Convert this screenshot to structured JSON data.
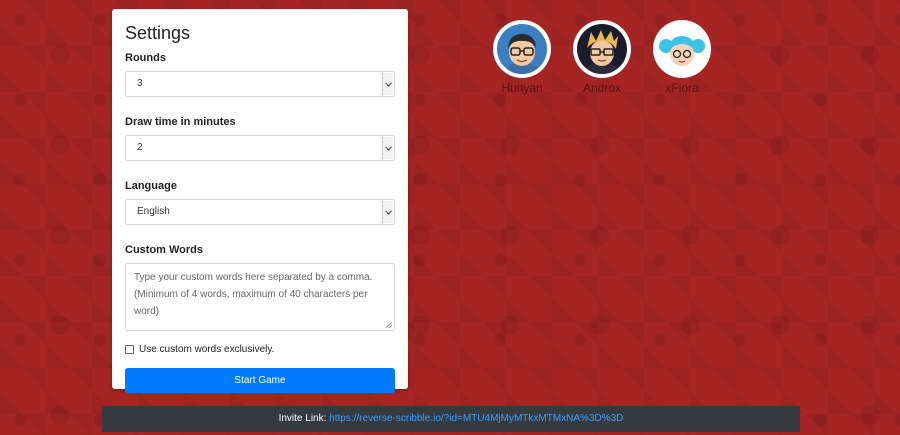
{
  "settings": {
    "title": "Settings",
    "rounds": {
      "label": "Rounds",
      "value": "3"
    },
    "draw_time": {
      "label": "Draw time in minutes",
      "value": "2"
    },
    "language": {
      "label": "Language",
      "value": "English"
    },
    "custom_words": {
      "label": "Custom Words",
      "placeholder": "Type your custom words here separated by a comma. (Minimum of 4 words, maximum of 40 characters per word)"
    },
    "exclusive_checkbox": {
      "label": "Use custom words exclusively.",
      "checked": false
    },
    "start_button": "Start Game"
  },
  "players": [
    {
      "name": "Hunyan",
      "avatar": "boy-glasses-avatar"
    },
    {
      "name": "Androx",
      "avatar": "blond-hair-glasses-avatar"
    },
    {
      "name": "xFiora",
      "avatar": "blue-hair-girl-avatar"
    }
  ],
  "invite": {
    "label": "Invite Link:",
    "url": "https://reverse-scribble.io/?id=MTU4MjMyMTkxMTMxNA%3D%3D"
  },
  "colors": {
    "background": "#a52424",
    "primary_button": "#007bff",
    "invite_bar": "#343a40",
    "link": "#3aa0ff"
  }
}
